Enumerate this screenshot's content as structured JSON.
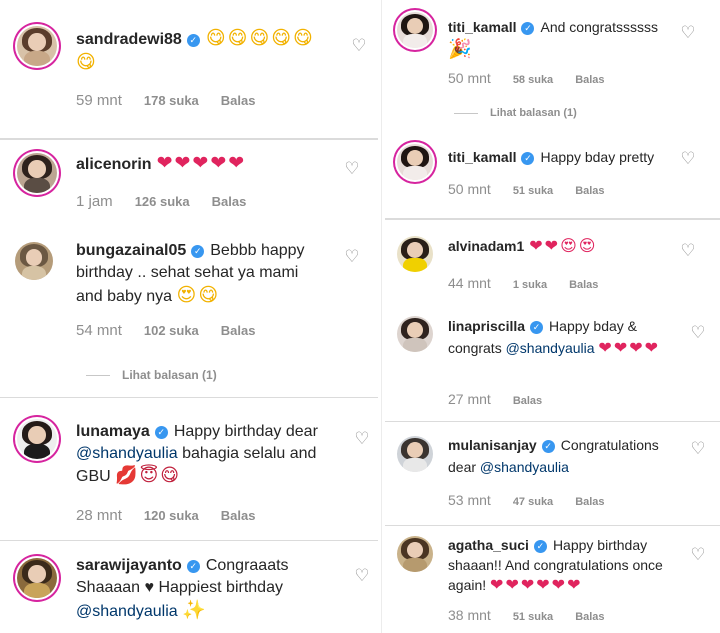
{
  "left": [
    {
      "user": "sandradewi88",
      "verified": true,
      "text": "",
      "emoji": "😋😋😋😋😋😋",
      "time": "59 mnt",
      "likes": "178 suka",
      "reply": "Balas"
    },
    {
      "user": "alicenorin",
      "verified": false,
      "text": "",
      "emoji": "❤❤❤❤❤",
      "time": "1 jam",
      "likes": "126 suka",
      "reply": "Balas"
    },
    {
      "user": "bungazainal05",
      "verified": true,
      "text": "Bebbb happy birthday .. sehat sehat ya mami and baby nya",
      "emoji": "😍😋",
      "time": "54 mnt",
      "likes": "102 suka",
      "reply": "Balas",
      "view_replies": "Lihat balasan (1)"
    },
    {
      "user": "lunamaya",
      "verified": true,
      "text": "Happy birthday dear",
      "mention": "@shandyaulia",
      "text2": "bahagia selalu and GBU",
      "emoji": "💋😇😋",
      "time": "28 mnt",
      "likes": "120 suka",
      "reply": "Balas"
    },
    {
      "user": "sarawijayanto",
      "verified": true,
      "text": "Congraaats Shaaaan ♥ Happiest birthday",
      "mention": "@shandyaulia",
      "emoji": "✨"
    }
  ],
  "right": [
    {
      "user": "titi_kamall",
      "verified": true,
      "text": "And congratssssss",
      "emoji": "🎉",
      "time": "50 mnt",
      "likes": "58 suka",
      "reply": "Balas",
      "view_replies": "Lihat balasan (1)"
    },
    {
      "user": "titi_kamall",
      "verified": true,
      "text": "Happy bday pretty",
      "emoji": "",
      "time": "50 mnt",
      "likes": "51 suka",
      "reply": "Balas"
    },
    {
      "user": "alvinadam1",
      "verified": false,
      "text": "",
      "emoji": "❤❤😍😍",
      "time": "44 mnt",
      "likes": "1 suka",
      "reply": "Balas"
    },
    {
      "user": "linapriscilla",
      "verified": true,
      "text": "Happy bday & congrats",
      "mention": "@shandyaulia",
      "emoji": "❤❤❤❤",
      "time": "27 mnt",
      "likes": "",
      "reply": "Balas"
    },
    {
      "user": "mulanisanjay",
      "verified": true,
      "text": "Congratulations dear",
      "mention": "@shandyaulia",
      "emoji": "",
      "time": "53 mnt",
      "likes": "47 suka",
      "reply": "Balas"
    },
    {
      "user": "agatha_suci",
      "verified": true,
      "text": "Happy birthday shaaan!! And congratulations once again!",
      "emoji": "❤❤❤❤❤❤",
      "time": "38 mnt",
      "likes": "51 suka",
      "reply": "Balas"
    }
  ]
}
